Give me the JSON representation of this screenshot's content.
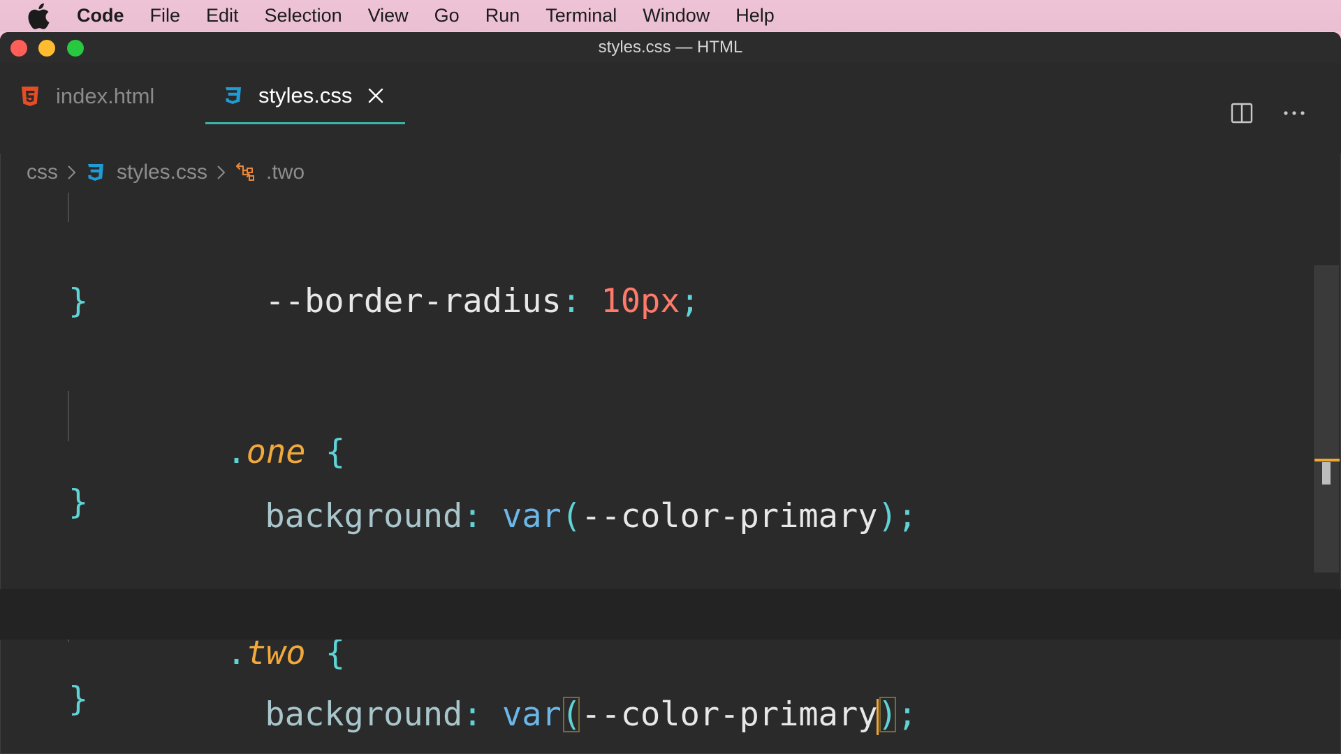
{
  "menubar": {
    "app_name": "Code",
    "items": [
      "File",
      "Edit",
      "Selection",
      "View",
      "Go",
      "Run",
      "Terminal",
      "Window",
      "Help"
    ]
  },
  "window": {
    "title": "styles.css — HTML"
  },
  "tabs": [
    {
      "label": "index.html",
      "icon": "html5-icon",
      "active": false
    },
    {
      "label": "styles.css",
      "icon": "css3-icon",
      "active": true
    }
  ],
  "breadcrumb": {
    "folder": "css",
    "file": "styles.css",
    "symbol": ".two"
  },
  "code": {
    "line1": {
      "prop": "--border-radius",
      "colon": ":",
      "value": "10px",
      "semi": ";"
    },
    "close1": "}",
    "rule_one": {
      "dot": ".",
      "name": "one",
      "brace": "{"
    },
    "one_decl": {
      "prop": "background",
      "colon": ":",
      "fn": "var",
      "open": "(",
      "var": "--color-primary",
      "close": ")",
      "semi": ";"
    },
    "close2": "}",
    "rule_two": {
      "dot": ".",
      "name": "two",
      "brace": "{"
    },
    "two_decl": {
      "prop": "background",
      "colon": ":",
      "fn": "var",
      "open": "(",
      "var": "--color-primary",
      "close": ")",
      "semi": ";"
    },
    "close3": "}"
  },
  "colors": {
    "accent_tab_underline": "#3ab5a8",
    "cursor": "#f0a830",
    "selector": "#f2a93b",
    "number": "#ff7a6a"
  }
}
